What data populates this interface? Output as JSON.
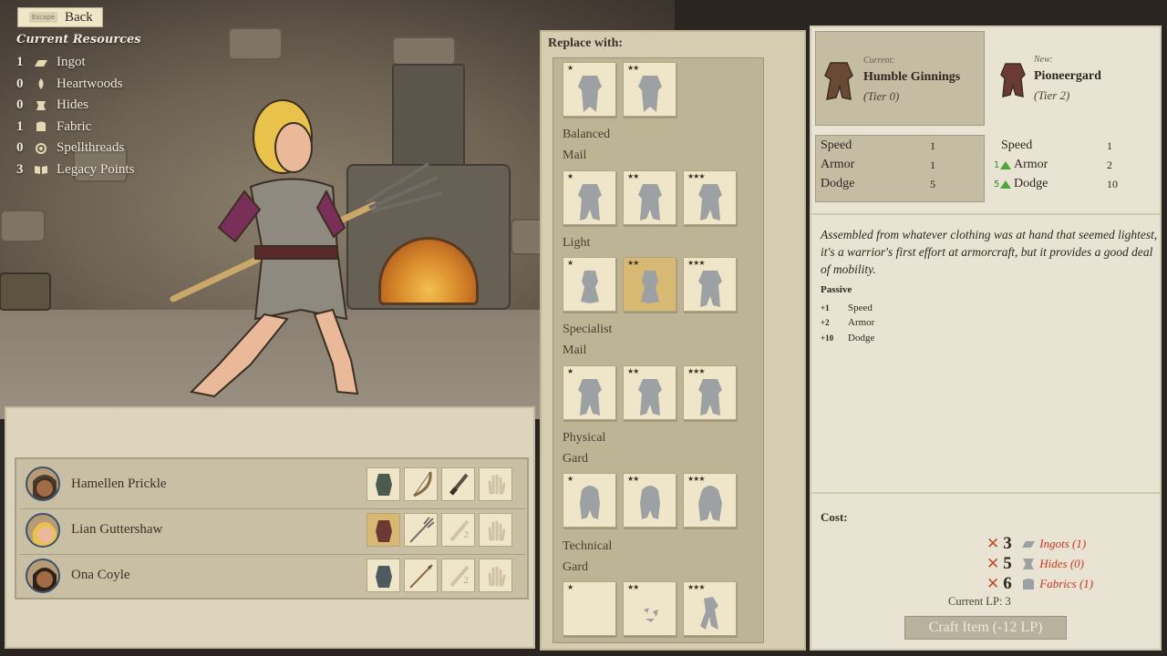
{
  "nav": {
    "escape_key": "Escape",
    "back_label": "Back"
  },
  "resources": {
    "title": "Current Resources",
    "items": [
      {
        "count": "1",
        "label": "Ingot",
        "icon": "ingot-icon"
      },
      {
        "count": "0",
        "label": "Heartwoods",
        "icon": "heartwood-icon"
      },
      {
        "count": "0",
        "label": "Hides",
        "icon": "hide-icon"
      },
      {
        "count": "1",
        "label": "Fabric",
        "icon": "fabric-icon"
      },
      {
        "count": "0",
        "label": "Spellthreads",
        "icon": "spellthread-icon"
      },
      {
        "count": "3",
        "label": "Legacy Points",
        "icon": "book-icon"
      }
    ]
  },
  "party": {
    "members": [
      {
        "name": "Hamellen Prickle",
        "slots": [
          "armor-icon",
          "bow-icon",
          "dagger-icon",
          "hand-icon"
        ]
      },
      {
        "name": "Lian Guttershaw",
        "slots": [
          "armor-icon",
          "pitchfork-icon",
          "sword-icon",
          "hand-icon"
        ],
        "slot3_badge": "2"
      },
      {
        "name": "Ona Coyle",
        "slots": [
          "armor-icon",
          "spear-icon",
          "sword-icon",
          "hand-icon"
        ],
        "slot3_badge": "2"
      }
    ]
  },
  "replace": {
    "header": "Replace with:",
    "categories": [
      {
        "label": "Balanced",
        "sub": "Mail"
      },
      {
        "label": "Light",
        "sub": ""
      },
      {
        "label": "Specialist",
        "sub": "Mail"
      },
      {
        "label": "Physical",
        "sub": "Gard"
      },
      {
        "label": "Technical",
        "sub": "Gard"
      }
    ],
    "star1": "★",
    "star2": "★★",
    "star3": "★★★"
  },
  "detail": {
    "current": {
      "caption": "Current:",
      "name": "Humble Ginnings",
      "tier": "(Tier 0)"
    },
    "new": {
      "caption": "New:",
      "name": "Pioneergard",
      "tier": "(Tier 2)"
    },
    "stats_current": [
      {
        "label": "Speed",
        "value": "1"
      },
      {
        "label": "Armor",
        "value": "1"
      },
      {
        "label": "Dodge",
        "value": "5"
      }
    ],
    "stats_new": [
      {
        "label": "Speed",
        "value": "1",
        "delta": ""
      },
      {
        "label": "Armor",
        "value": "2",
        "delta": "1"
      },
      {
        "label": "Dodge",
        "value": "10",
        "delta": "5"
      }
    ],
    "description": "Assembled from whatever clothing was at hand that seemed lightest, it's a warrior's first effort at armorcraft, but it provides a good deal of mobility.",
    "passive_title": "Passive",
    "passive": [
      {
        "amount": "+1",
        "label": "Speed"
      },
      {
        "amount": "+2",
        "label": "Armor"
      },
      {
        "amount": "+10",
        "label": "Dodge"
      }
    ],
    "cost_title": "Cost:",
    "costs": [
      {
        "amount": "3",
        "label": "Ingots (1)",
        "icon": "ingot-icon"
      },
      {
        "amount": "5",
        "label": "Hides (0)",
        "icon": "hide-icon"
      },
      {
        "amount": "6",
        "label": "Fabrics (1)",
        "icon": "fabric-icon"
      }
    ],
    "current_lp": "Current LP: 3",
    "craft_label": "Craft Item (-12 LP)"
  },
  "colors": {
    "accent_gold": "#d8b974",
    "cost_red": "#c8361f",
    "up_green": "#4ca63a"
  }
}
